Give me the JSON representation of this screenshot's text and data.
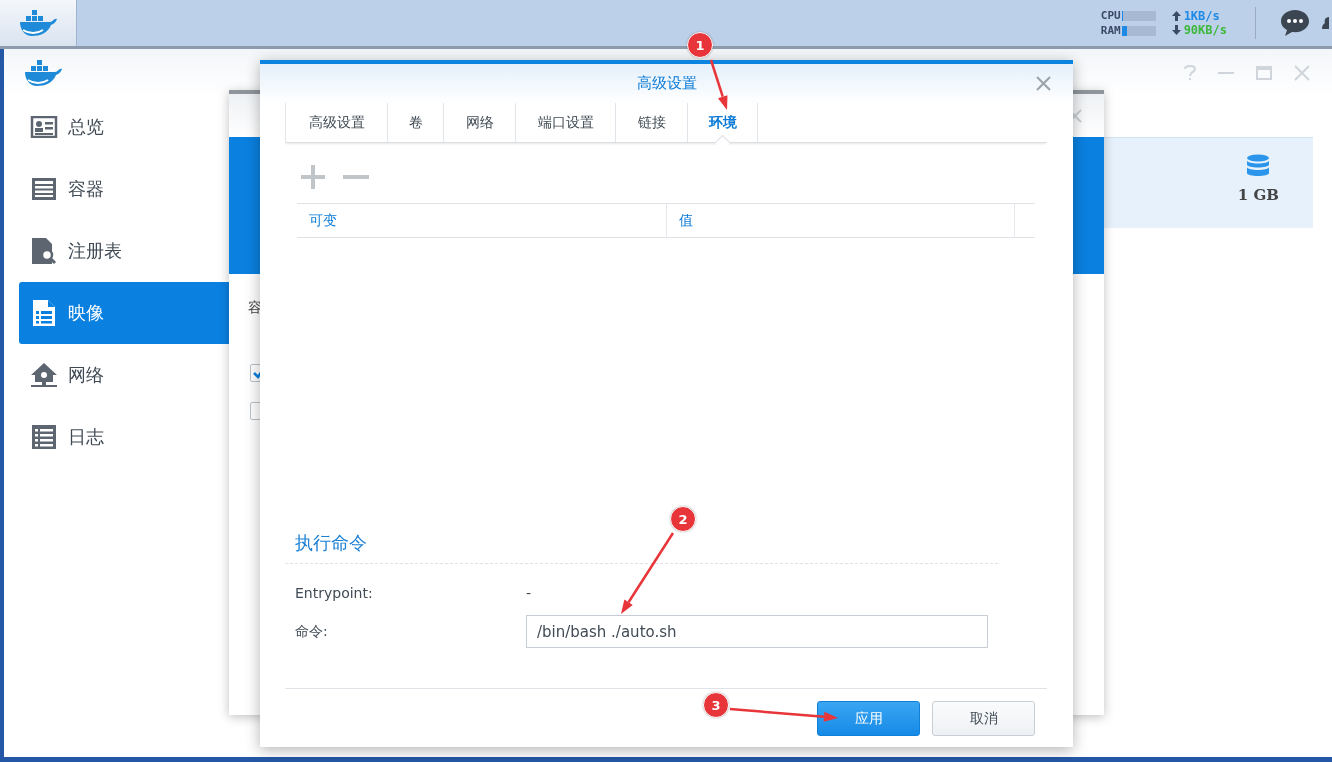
{
  "taskbar": {
    "cpu": {
      "label": "CPU",
      "level": 0.03
    },
    "ram": {
      "label": "RAM",
      "level": 0.15
    },
    "upload": "1KB/s",
    "download": "90KB/s"
  },
  "app_window": {
    "sidebar": {
      "items": [
        {
          "label": "总览",
          "selected": false
        },
        {
          "label": "容器",
          "selected": false
        },
        {
          "label": "注册表",
          "selected": false
        },
        {
          "label": "映像",
          "selected": true
        },
        {
          "label": "网络",
          "selected": false
        },
        {
          "label": "日志",
          "selected": false
        }
      ]
    },
    "storage": "1 GB",
    "background_dialog": {
      "text": "容",
      "checkboxes": [
        {
          "checked": true
        },
        {
          "checked": false
        }
      ]
    }
  },
  "dialog": {
    "title": "高级设置",
    "tabs": [
      {
        "label": "高级设置",
        "selected": false
      },
      {
        "label": "卷",
        "selected": false
      },
      {
        "label": "网络",
        "selected": false
      },
      {
        "label": "端口设置",
        "selected": false
      },
      {
        "label": "链接",
        "selected": false
      },
      {
        "label": "环境",
        "selected": true
      }
    ],
    "table": {
      "columns": [
        "可变",
        "值"
      ]
    },
    "section_title": "执行命令",
    "fields": [
      {
        "label": "Entrypoint:",
        "kind": "text",
        "value": "-"
      },
      {
        "label": "命令:",
        "kind": "input",
        "value": "/bin/bash ./auto.sh"
      }
    ],
    "buttons": [
      {
        "label": "应用",
        "kind": "primary"
      },
      {
        "label": "取消",
        "kind": "secondary"
      }
    ]
  },
  "annotations": [
    {
      "label": "1"
    },
    {
      "label": "2"
    },
    {
      "label": "3"
    }
  ]
}
